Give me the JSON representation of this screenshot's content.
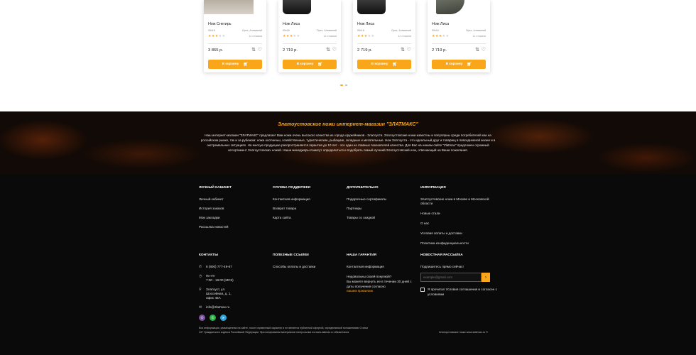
{
  "products": [
    {
      "name": "Нож Снегирь",
      "meta_left": "95х18",
      "meta_right": "Орех, Алюминий",
      "stars_on": 3,
      "reviews": "12 отзывов",
      "price": "3 865 р.",
      "cart_label": "В корзину"
    },
    {
      "name": "Нож Лиса",
      "meta_left": "95х18",
      "meta_right": "Орех, Алюминий",
      "stars_on": 3,
      "reviews": "12 отзывов",
      "price": "2 719 р.",
      "cart_label": "В корзину"
    },
    {
      "name": "Нож Лиса",
      "meta_left": "95х18",
      "meta_right": "Орех, Алюминий",
      "stars_on": 3,
      "reviews": "12 отзывов",
      "price": "2 719 р.",
      "cart_label": "В корзину"
    },
    {
      "name": "Нож Лиса",
      "meta_left": "95х18",
      "meta_right": "Орех, Алюминий",
      "stars_on": 3,
      "reviews": "12 отзывов",
      "price": "2 719 р.",
      "cart_label": "В корзину"
    }
  ],
  "pager": {
    "count": 2,
    "active": 0
  },
  "banner": {
    "title": "Златоустовские ножи интернет-магазин \"ЗЛАТМАКС\"",
    "text": "Наш интернет-магазин \"ЗЛАТМАКС\" предлагает Вам ножи очень высокого качества из города оружейников - Златоуста. Златоустовские ножи известны и популярны среди потребителей как на российском рынке, так и за рубежом: ножи охотничьи, хозяйственные, туристические, рыбацкие, складные и метательные. Нож Златоуста - это идеальный друг и товарищ в повседневной жизни и в экстремальных ситуациях. На многую продукцию распространяется гарантия до 10 лет - это один из главных показателей качества. Для Вас на нашем сайте \"Zlatmax\" предложен огромный ассортимент Златоустовских ножей. Наши менеджеры помогут определиться и подобрать самый лучший Златоустовский нож, отвечающий на Ваши пожелания."
  },
  "footer": {
    "account": {
      "heading": "Личный кабинет",
      "links": [
        "Личный кабинет",
        "История заказов",
        "Мои закладки",
        "Рассылка новостей"
      ]
    },
    "support": {
      "heading": "Служба поддержки",
      "links": [
        "Контактная информация",
        "Возврат товара",
        "Карта сайта"
      ]
    },
    "extra": {
      "heading": "Дополнительно",
      "links": [
        "Подарочные сертификаты",
        "Партнеры",
        "Товары со скидкой"
      ]
    },
    "info": {
      "heading": "Информация",
      "links": [
        "Златоустовские ножи в Москве и Московской области",
        "Новые стали",
        "О нас",
        "Условия оплаты и доставки",
        "Политика конфиденциальности"
      ]
    },
    "contacts": {
      "heading": "Контакты",
      "phone": "8 (800) 777-49-67",
      "hours_days": "Пн-Пт",
      "hours_time": "7:00 - 16:00 (МСК)",
      "address": "Златоуст, ул. Шоссейная, д. 1, офис 46А",
      "email": "info@zlatmax.ru"
    },
    "useful": {
      "heading": "Полезные ссылки",
      "links": [
        "Способы оплаты и доставки"
      ]
    },
    "guarantee": {
      "heading": "Наша гарантия",
      "link": "Контактная информация",
      "question": "Недовольны своей покупкой?",
      "text": "Вы можете вернуть ее в течении 30 дней с даты получения согласно",
      "rules_link": "нашим правилам"
    },
    "newsletter": {
      "heading": "Новостная рассылка",
      "subtitle": "Подпишитесь прямо сейчас!",
      "placeholder": "example@gmail.com",
      "agree": "Я прочитал Условия соглашения и согласен с условиями"
    },
    "legal": "Вся информация, размещенная на сайте, носит справочный характер и не является публичной офертой, определяемой положениями Статьи 437 Гражданского кодекса Российской Федерации. При копировании материалов гиперссылка на www.zlatmax.ru обязательна",
    "copyright": "Златоустовские ножи www.zlatmax.ru ©"
  },
  "colors": {
    "accent": "#f9a61a",
    "footer_bg": "#0a0a0a"
  }
}
